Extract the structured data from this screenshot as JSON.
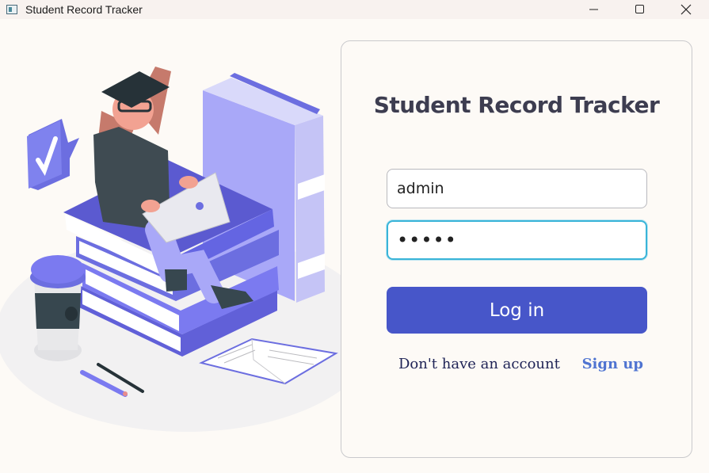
{
  "window": {
    "title": "Student Record Tracker",
    "icons": {
      "app": "app-icon",
      "minimize": "minimize-icon",
      "maximize": "maximize-icon",
      "close": "close-icon"
    }
  },
  "illustration": {
    "icon": "graduate-studying-illustration"
  },
  "login": {
    "title": "Student Record Tracker",
    "username_value": "admin",
    "password_value": "•••••",
    "login_label": "Log in",
    "no_account_text": "Don't have an account",
    "signup_label": "Sign up"
  },
  "colors": {
    "accent": "#4756c9",
    "focus_border": "#39b4d8",
    "link": "#4f74d1",
    "title_text": "#3d3d50"
  }
}
